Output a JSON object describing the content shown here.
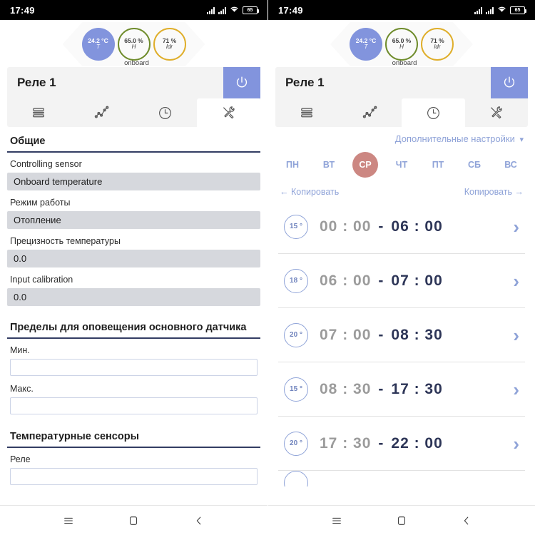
{
  "statusbar": {
    "time": "17:49",
    "battery_level": "65",
    "icons": [
      "signal-icon",
      "signal-icon",
      "wifi-icon",
      "battery-icon"
    ]
  },
  "sensors": {
    "label": "onboard",
    "gauges": [
      {
        "value": "24.2 °C",
        "unit": "T",
        "style": "filled",
        "color": "#8294dd"
      },
      {
        "value": "65.0 %",
        "unit": "H",
        "style": "ring-green",
        "color": "#6f8c2c"
      },
      {
        "value": "71 %",
        "unit": "ldr",
        "style": "ring-yellow",
        "color": "#dfae2a"
      }
    ]
  },
  "card": {
    "title": "Реле 1",
    "power_icon": "power-icon",
    "power_color": "#8294dd",
    "tabs": [
      {
        "name": "tab-list",
        "icon": "list-icon"
      },
      {
        "name": "tab-chart",
        "icon": "chart-line-icon"
      },
      {
        "name": "tab-schedule",
        "icon": "clock-icon"
      },
      {
        "name": "tab-settings",
        "icon": "tools-icon"
      }
    ],
    "left_active_tab": 3,
    "right_active_tab": 2
  },
  "settings": {
    "section_general": "Общие",
    "controlling_sensor_label": "Controlling sensor",
    "controlling_sensor_value": "Onboard temperature",
    "mode_label": "Режим работы",
    "mode_value": "Отопление",
    "precision_label": "Прецизность температуры",
    "precision_value": "0.0",
    "input_calibration_label": "Input calibration",
    "input_calibration_value": "0.0",
    "section_limits": "Пределы для оповещения основного датчика",
    "min_label": "Мин.",
    "min_value": "",
    "max_label": "Макс.",
    "max_value": "",
    "section_sensors": "Температурные сенсоры",
    "relay_label": "Реле",
    "relay_value": ""
  },
  "schedule": {
    "advanced_label": "Дополнительные настройки",
    "advanced_chevron": "chevron-down-icon",
    "days": [
      {
        "label": "ПН",
        "selected": false
      },
      {
        "label": "ВТ",
        "selected": false
      },
      {
        "label": "СР",
        "selected": true
      },
      {
        "label": "ЧТ",
        "selected": false
      },
      {
        "label": "ПТ",
        "selected": false
      },
      {
        "label": "СБ",
        "selected": false
      },
      {
        "label": "ВС",
        "selected": false
      }
    ],
    "selected_day_color": "#cc8782",
    "copy_left": "← Копировать",
    "copy_right": "Копировать →",
    "rows": [
      {
        "temp": "15 °",
        "start": "00 : 00",
        "dash": "-",
        "end": "06 : 00"
      },
      {
        "temp": "18 °",
        "start": "06 : 00",
        "dash": "-",
        "end": "07 : 00"
      },
      {
        "temp": "20 °",
        "start": "07 : 00",
        "dash": "-",
        "end": "08 : 30"
      },
      {
        "temp": "15 °",
        "start": "08 : 30",
        "dash": "-",
        "end": "17 : 30"
      },
      {
        "temp": "20 °",
        "start": "17 : 30",
        "dash": "-",
        "end": "22 : 00"
      }
    ],
    "row_chevron": "chevron-right-icon"
  },
  "navbar": {
    "items": [
      {
        "name": "recent-apps-icon",
        "glyph": "≡"
      },
      {
        "name": "home-icon",
        "glyph": "▢"
      },
      {
        "name": "back-icon",
        "glyph": "‹"
      }
    ]
  }
}
